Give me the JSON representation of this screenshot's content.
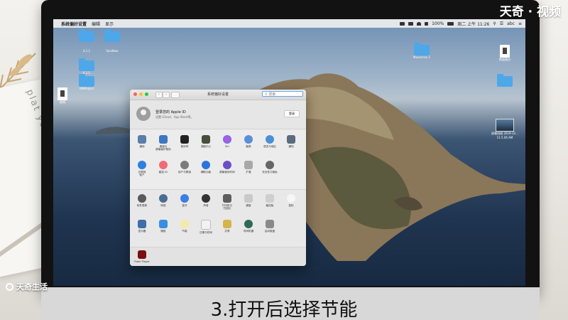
{
  "watermark": {
    "top_right": "天奇 · 视频",
    "bottom_left": "天奇生活"
  },
  "caption": "3.打开后选择节能",
  "desk": {
    "paper_text": "plat your life"
  },
  "menubar": {
    "app": "系统偏好设置",
    "items": [
      "编辑",
      "显示"
    ],
    "battery": "100%",
    "datetime": "周二 上午 11:26",
    "extra": "abc"
  },
  "desktop_icons": [
    {
      "label": "4.1.1"
    },
    {
      "label": "Sandbox"
    },
    {
      "label": "6.1.1"
    },
    {
      "label": "UNIProject"
    },
    {
      "label": "视频"
    },
    {
      "label": "Mavericks 2"
    },
    {
      "label": "数据备份"
    },
    {
      "label": "屏幕快照 2019-12... 11.5.06 AM"
    }
  ],
  "window": {
    "title": "系统偏好设置",
    "search_placeholder": "搜索",
    "account_title": "登录您的 Apple ID",
    "account_sub": "设置 iCloud、App Store等。",
    "login_button": "登录",
    "row1": [
      "通用",
      "桌面与\n屏幕保护程序",
      "程序坞",
      "调度中心",
      "Siri",
      "聚焦",
      "语言与地区",
      "通知"
    ],
    "row2": [
      "互联网\n帐户",
      "触控 ID",
      "用户与群组",
      "辅助功能",
      "屏幕使用时间",
      "扩展",
      "安全性与隐私"
    ],
    "row3": [
      "软件更新",
      "网络",
      "蓝牙",
      "声音",
      "打印机与\n扫描仪",
      "键盘",
      "触控板",
      "鼠标"
    ],
    "row4": [
      "显示器",
      "随航",
      "节能",
      "日期与时间",
      "共享",
      "时间机器",
      "启动磁盘"
    ],
    "row5": [
      "Flash Player"
    ]
  },
  "colors": {
    "accent": "#3a86f0",
    "close": "#ff5f57",
    "minimize": "#febc2e",
    "zoom": "#28c840"
  }
}
